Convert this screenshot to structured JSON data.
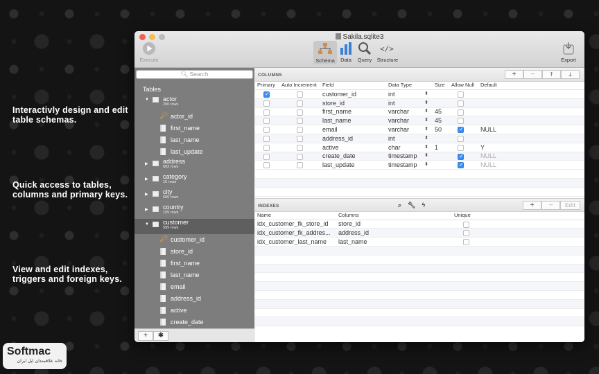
{
  "promo": [
    "Interactivly design and edit table schemas.",
    "Quick access to tables, columns and primary keys.",
    "View and edit indexes, triggers and foreign keys."
  ],
  "watermark": {
    "brand": "Softmac",
    "sub": "خانه علاقمندان اپل ایران"
  },
  "window": {
    "title": "Sakila.sqlite3",
    "toolbar": {
      "execute": "Execute",
      "schema": "Schema",
      "data": "Data",
      "query": "Query",
      "structure": "Structure",
      "export": "Export"
    }
  },
  "sidebar": {
    "search_placeholder": "Search",
    "tables_heading": "Tables",
    "actor": {
      "name": "actor",
      "rows": "200 rows",
      "columns": [
        "actor_id",
        "first_name",
        "last_name",
        "last_update"
      ]
    },
    "collapsed": [
      {
        "name": "address",
        "rows": "603 rows"
      },
      {
        "name": "category",
        "rows": "16 rows"
      },
      {
        "name": "city",
        "rows": "600 rows"
      },
      {
        "name": "country",
        "rows": "109 rows"
      }
    ],
    "customer": {
      "name": "customer",
      "rows": "599 rows",
      "columns": [
        "customer_id",
        "store_id",
        "first_name",
        "last_name",
        "email",
        "address_id",
        "active",
        "create_date"
      ]
    },
    "footer": {
      "add": "+",
      "gear": "✱"
    }
  },
  "columns_section": {
    "label": "COLUMNS",
    "buttons": {
      "add": "+",
      "remove": "−",
      "up": "🡑",
      "down": "🡓"
    },
    "headers": [
      "Primary",
      "Auto Increment",
      "Field",
      "Data Type",
      "Size",
      "Allow Null",
      "Default"
    ],
    "rows": [
      {
        "primary": true,
        "field": "customer_id",
        "type": "int",
        "size": "",
        "allow_null": false,
        "default": ""
      },
      {
        "primary": false,
        "field": "store_id",
        "type": "int",
        "size": "",
        "allow_null": false,
        "default": ""
      },
      {
        "primary": false,
        "field": "first_name",
        "type": "varchar",
        "size": "45",
        "allow_null": false,
        "default": ""
      },
      {
        "primary": false,
        "field": "last_name",
        "type": "varchar",
        "size": "45",
        "allow_null": false,
        "default": ""
      },
      {
        "primary": false,
        "field": "email",
        "type": "varchar",
        "size": "50",
        "allow_null": true,
        "default": "NULL"
      },
      {
        "primary": false,
        "field": "address_id",
        "type": "int",
        "size": "",
        "allow_null": false,
        "default": ""
      },
      {
        "primary": false,
        "field": "active",
        "type": "char",
        "size": "1",
        "allow_null": false,
        "default": "Y"
      },
      {
        "primary": false,
        "field": "create_date",
        "type": "timestamp",
        "size": "",
        "allow_null": true,
        "default": "NULL"
      },
      {
        "primary": false,
        "field": "last_update",
        "type": "timestamp",
        "size": "",
        "allow_null": true,
        "default": "NULL"
      }
    ]
  },
  "indexes_section": {
    "label": "INDEXES",
    "buttons": {
      "add": "+",
      "remove": "−",
      "edit": "Edit"
    },
    "headers": [
      "Name",
      "Columns",
      "Unique"
    ],
    "rows": [
      {
        "name": "idx_customer_fk_store_id",
        "columns": "store_id"
      },
      {
        "name": "idx_customer_fk_addres...",
        "columns": "address_id"
      },
      {
        "name": "idx_customer_last_name",
        "columns": "last_name"
      }
    ]
  }
}
